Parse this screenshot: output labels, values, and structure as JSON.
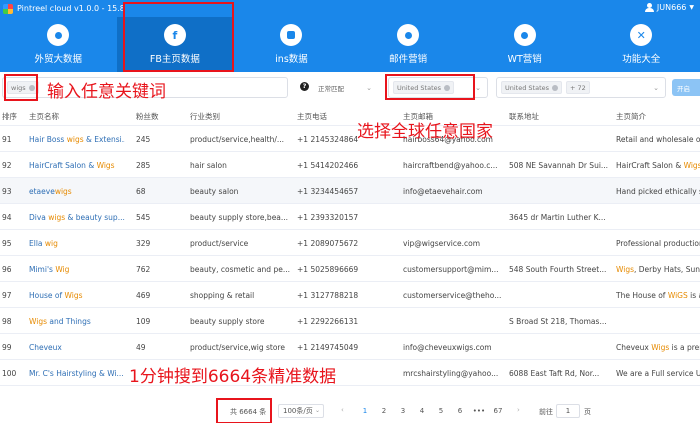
{
  "titlebar": {
    "title": "Pintreel cloud v1.0.0 - 15.8",
    "user": "JUN666"
  },
  "nav": [
    {
      "label": "外贸大数据",
      "icon": "globe-icon"
    },
    {
      "label": "FB主页数据",
      "icon": "facebook-icon",
      "active": true
    },
    {
      "label": "ins数据",
      "icon": "instagram-icon"
    },
    {
      "label": "邮件营销",
      "icon": "email-icon"
    },
    {
      "label": "WT营销",
      "icon": "whatsapp-icon"
    },
    {
      "label": "功能大全",
      "icon": "tools-icon"
    }
  ],
  "filters": {
    "keyword_tag": "wigs",
    "match_mode": "正常匹配",
    "country_tag": "United States",
    "country_tag2": "United States",
    "country_more": "+ 72",
    "open_button": "开启"
  },
  "annotations": {
    "keyword": "输入任意关键词",
    "country": "选择全球任意国家",
    "result": "1分钟搜到6664条精准数据"
  },
  "columns": [
    "排序",
    "主页名称",
    "粉丝数",
    "行业类别",
    "主页电话",
    "主页邮箱",
    "联系地址",
    "主页简介"
  ],
  "rows": [
    {
      "idx": "91",
      "name": [
        "Hair Boss ",
        "wigs",
        " & Extensi..."
      ],
      "fans": "245",
      "category": "product/service,health/...",
      "phone": "+1 2145324864",
      "email": "hairboss64@yahoo.com",
      "address": "",
      "bio": [
        "Retail and wholesale of ",
        "",
        ""
      ]
    },
    {
      "idx": "92",
      "name": [
        "HairCraft Salon & ",
        "Wigs",
        ""
      ],
      "fans": "285",
      "category": "hair salon",
      "phone": "+1 5414202466",
      "email": "haircraftbend@yahoo.c...",
      "address": "508 NE Savannah Dr Sui...",
      "bio": [
        "HairCraft Salon & ",
        "Wigs",
        ""
      ]
    },
    {
      "idx": "93",
      "name": [
        "etaeve",
        "wigs",
        ""
      ],
      "fans": "68",
      "category": "beauty salon",
      "phone": "+1 3234454657",
      "email": "info@etaevehair.com",
      "address": "",
      "bio": [
        "Hand picked ethically so",
        "",
        ""
      ]
    },
    {
      "idx": "94",
      "name": [
        "Diva ",
        "wigs",
        " & beauty sup..."
      ],
      "fans": "545",
      "category": "beauty supply store,bea...",
      "phone": "+1 2393320157",
      "email": "",
      "address": "3645 dr Martin Luther K...",
      "bio": [
        "",
        "",
        ""
      ]
    },
    {
      "idx": "95",
      "name": [
        "Ella ",
        "wig",
        ""
      ],
      "fans": "329",
      "category": "product/service",
      "phone": "+1 2089075672",
      "email": "vip@wigservice.com",
      "address": "",
      "bio": [
        "Professional production",
        "",
        ""
      ]
    },
    {
      "idx": "96",
      "name": [
        "Mimi's ",
        "Wig",
        ""
      ],
      "fans": "762",
      "category": "beauty, cosmetic and pe...",
      "phone": "+1 5025896669",
      "email": "customersupport@mim...",
      "address": "548 South Fourth Street...",
      "bio": [
        "",
        "Wigs",
        ", Derby Hats, Sung"
      ]
    },
    {
      "idx": "97",
      "name": [
        "House of ",
        "Wigs",
        ""
      ],
      "fans": "469",
      "category": "shopping & retail",
      "phone": "+1 3127788218",
      "email": "customerservice@theho...",
      "address": "",
      "bio": [
        "The House of ",
        "WiGS",
        " is a f"
      ]
    },
    {
      "idx": "98",
      "name": [
        "",
        "Wigs",
        " and Things"
      ],
      "fans": "109",
      "category": "beauty supply store",
      "phone": "+1 2292266131",
      "email": "",
      "address": "S Broad St 218, Thomas...",
      "bio": [
        "",
        "",
        ""
      ]
    },
    {
      "idx": "99",
      "name": [
        "Cheveux",
        "",
        ""
      ],
      "fans": "49",
      "category": "product/service,wig store",
      "phone": "+1 2149745049",
      "email": "info@cheveuxwigs.com",
      "address": "",
      "bio": [
        "Cheveux ",
        "Wigs",
        " is a prem"
      ]
    },
    {
      "idx": "100",
      "name": [
        "Mr. C's Hairstyling & Wi...",
        "",
        ""
      ],
      "fans": "",
      "category": "",
      "phone": "",
      "email": "mrcshairstyling@yahoo...",
      "address": "6088 East Taft Rd, Nor...",
      "bio": [
        "We are a Full service Un",
        "",
        ""
      ]
    }
  ],
  "pager": {
    "total": "共 6664 条",
    "page_size": "100条/页",
    "pages": [
      "1",
      "2",
      "3",
      "4",
      "5",
      "6",
      "•••",
      "67"
    ],
    "goto_label": "前往",
    "goto_value": "1",
    "page_unit": "页"
  },
  "colors": {
    "primary": "#1a87ea",
    "annotation": "#e8141c",
    "highlight": "#e68a00",
    "link": "#2f6fb5"
  }
}
